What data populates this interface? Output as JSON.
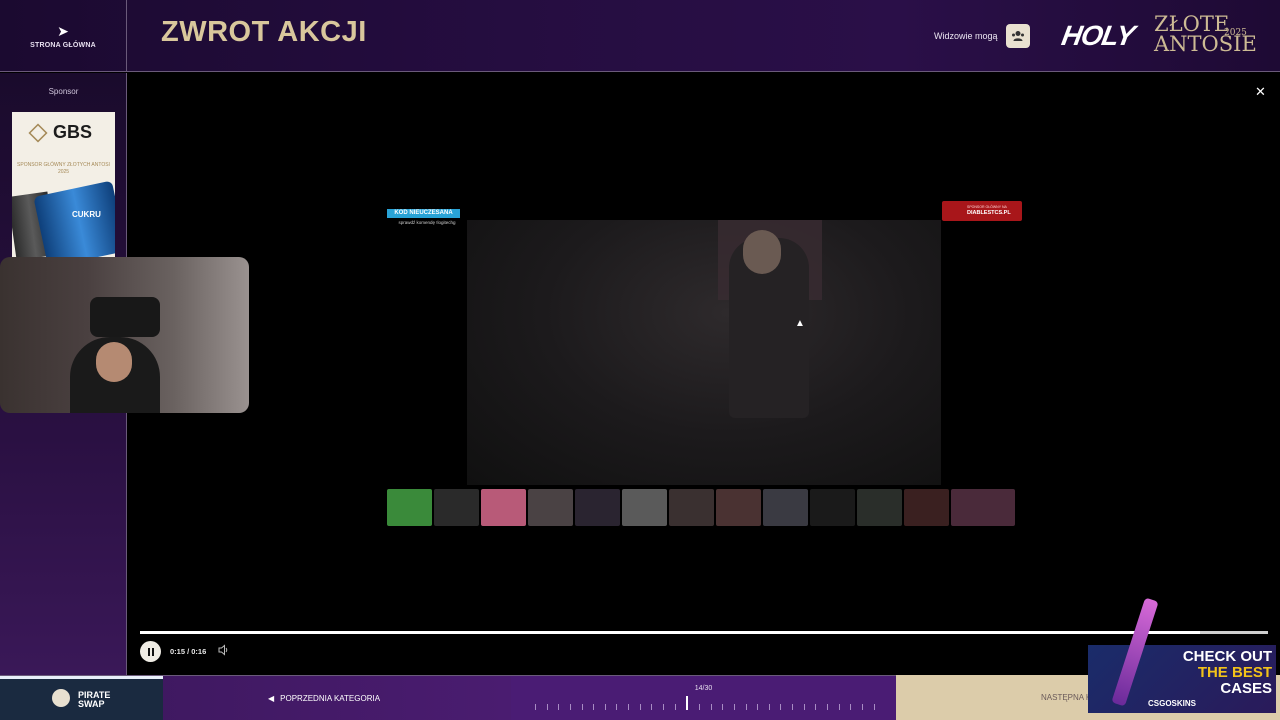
{
  "header": {
    "home_label": "STRONA GŁÓWNA",
    "title": "ZWROT AKCJI",
    "viewers_label": "Widzowie mogą",
    "logo_holy": "HOLY",
    "logo_zlote": "ZŁOTE",
    "logo_antosie": "ANTOSIE",
    "logo_year": "2025"
  },
  "sidebar": {
    "sponsor_label": "Sponsor",
    "sponsor_brand": "GBS",
    "sponsor_tagline": "SPONSOR GŁÓWNY ZŁOTYCH ANTOSI 2025",
    "sponsor_can_text": "CUKRU"
  },
  "video": {
    "code_tag": "KOD NIEUCZESANA",
    "code_sub": "sprawdź komendę !logitechg",
    "diablest_sub": "SPONSOR GŁÓWNY NA",
    "diablest": "DIABLESTCS.PL"
  },
  "player": {
    "time": "0:15 / 0:16",
    "progress": 0.94
  },
  "bottom_bar": {
    "pirate_line1": "PIRATE",
    "pirate_line2": "SWAP",
    "prev_label": "POPRZEDNIA KATEGORIA",
    "counter": "14/30",
    "current": 14,
    "total": 30,
    "next_label": "NASTĘPNA KA"
  },
  "ad": {
    "line1": "CHECK OUT",
    "line2": "THE BEST",
    "line3": "CASES",
    "brand": "CSGOSKINS"
  },
  "colors": {
    "header_bg": "#250d40",
    "title_gold": "#d9c79c",
    "accent_purple": "#4a1c74",
    "next_bg": "#dcccaa"
  }
}
